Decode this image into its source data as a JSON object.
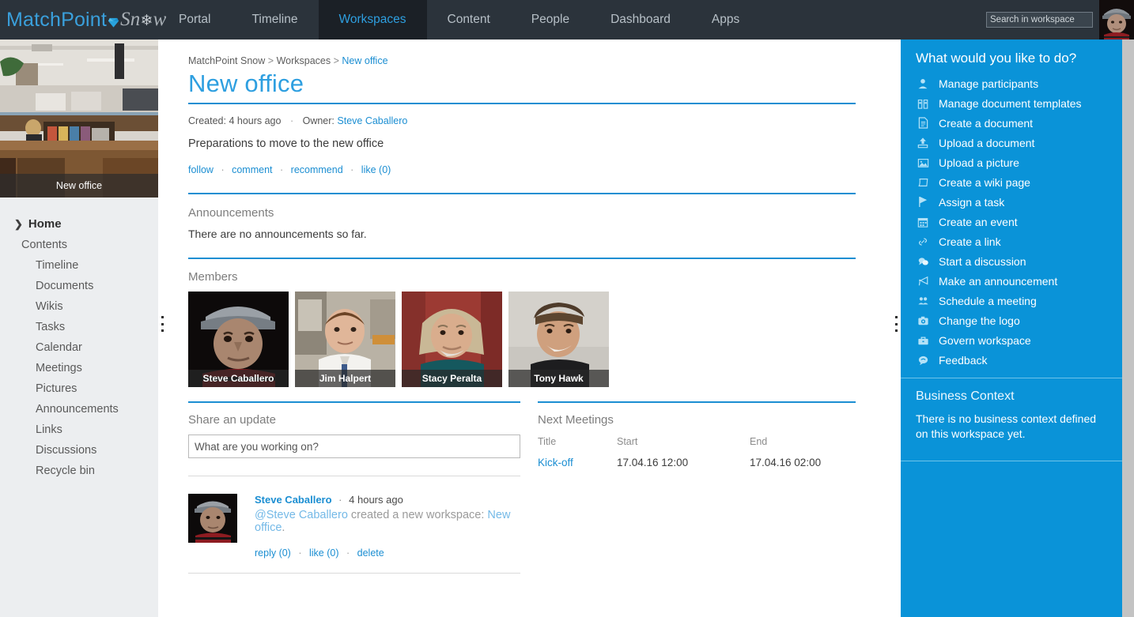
{
  "brand": {
    "part1": "MatchPoint",
    "gem_icon": "gem-icon",
    "part2a": "Sn",
    "snowflake": "❄",
    "part2b": "w"
  },
  "topnav": {
    "tabs": [
      {
        "label": "Portal",
        "active": false
      },
      {
        "label": "Timeline",
        "active": false
      },
      {
        "label": "Workspaces",
        "active": true
      },
      {
        "label": "Content",
        "active": false
      },
      {
        "label": "People",
        "active": false
      },
      {
        "label": "Dashboard",
        "active": false
      },
      {
        "label": "Apps",
        "active": false
      }
    ],
    "search": {
      "placeholder": "Search in workspace",
      "value": ""
    },
    "avatar_name": "Steve Caballero"
  },
  "sidebar": {
    "workspace_image_caption": "New office",
    "home": {
      "label": "Home",
      "icon": "chevron-right-icon"
    },
    "contents_label": "Contents",
    "items": [
      {
        "label": "Timeline"
      },
      {
        "label": "Documents"
      },
      {
        "label": "Wikis"
      },
      {
        "label": "Tasks"
      },
      {
        "label": "Calendar"
      },
      {
        "label": "Meetings"
      },
      {
        "label": "Pictures"
      },
      {
        "label": "Announcements"
      },
      {
        "label": "Links"
      },
      {
        "label": "Discussions"
      },
      {
        "label": "Recycle bin"
      }
    ]
  },
  "main": {
    "breadcrumb": {
      "root": "MatchPoint Snow",
      "level2": "Workspaces",
      "current": "New office",
      "separator": ">"
    },
    "title": "New office",
    "meta": {
      "created_label": "Created:",
      "created_value": "4 hours ago",
      "separator": "·",
      "owner_label": "Owner:",
      "owner_value": "Steve Caballero"
    },
    "description": "Preparations to move to the new office",
    "actions": [
      {
        "label": "follow"
      },
      {
        "label": "comment"
      },
      {
        "label": "recommend"
      },
      {
        "label": "like (0)"
      }
    ],
    "announcements": {
      "heading": "Announcements",
      "empty_text": "There are no announcements so far."
    },
    "members": {
      "heading": "Members",
      "list": [
        {
          "name": "Steve Caballero"
        },
        {
          "name": "Jim Halpert"
        },
        {
          "name": "Stacy Peralta"
        },
        {
          "name": "Tony Hawk"
        }
      ]
    },
    "share_update": {
      "heading": "Share an update",
      "placeholder": "What are you working on?",
      "value": ""
    },
    "next_meetings": {
      "heading": "Next Meetings",
      "columns": [
        "Title",
        "Start",
        "End"
      ],
      "rows": [
        {
          "title": "Kick-off",
          "start": "17.04.16 12:00",
          "end": "17.04.16 02:00"
        }
      ]
    },
    "feed": [
      {
        "author": "Steve Caballero",
        "separator": "·",
        "timestamp": "4 hours ago",
        "text_mention": "@Steve Caballero",
        "text_middle": " created a new workspace: ",
        "text_link": "New office",
        "text_end": ".",
        "links": [
          {
            "label": "reply (0)"
          },
          {
            "label": "like (0)"
          },
          {
            "label": "delete"
          }
        ]
      }
    ]
  },
  "rightpanel": {
    "title": "What would you like to do?",
    "items": [
      {
        "label": "Manage participants",
        "icon": "person-icon",
        "glyph": "👤"
      },
      {
        "label": "Manage document templates",
        "icon": "binders-icon",
        "glyph": "‖"
      },
      {
        "label": "Create a document",
        "icon": "document-icon",
        "glyph": "☰"
      },
      {
        "label": "Upload a document",
        "icon": "upload-icon",
        "glyph": "⬆"
      },
      {
        "label": "Upload a picture",
        "icon": "picture-icon",
        "glyph": "⛰"
      },
      {
        "label": "Create a wiki page",
        "icon": "wiki-page-icon",
        "glyph": "◱"
      },
      {
        "label": "Assign a task",
        "icon": "flag-icon",
        "glyph": "▶"
      },
      {
        "label": "Create an event",
        "icon": "calendar-icon",
        "glyph": "▦"
      },
      {
        "label": "Create a link",
        "icon": "link-icon",
        "glyph": "🔗"
      },
      {
        "label": "Start a discussion",
        "icon": "chat-bubble-icon",
        "glyph": "💬"
      },
      {
        "label": "Make an announcement",
        "icon": "megaphone-icon",
        "glyph": "📣"
      },
      {
        "label": "Schedule a meeting",
        "icon": "people-icon",
        "glyph": "👥"
      },
      {
        "label": "Change the logo",
        "icon": "camera-icon",
        "glyph": "📷"
      },
      {
        "label": "Govern workspace",
        "icon": "briefcase-icon",
        "glyph": "💼"
      },
      {
        "label": "Feedback",
        "icon": "feedback-icon",
        "glyph": "🗨"
      }
    ],
    "business_context": {
      "title": "Business Context",
      "text": "There is no business context defined on this workspace yet."
    }
  },
  "colors": {
    "header_bg": "#2b333b",
    "header_active_bg": "#1b2026",
    "accent_blue": "#1b8ed2",
    "panel_blue": "#0a93d8",
    "title_blue": "#2e9fe0",
    "sidebar_bg": "#eceef0"
  }
}
